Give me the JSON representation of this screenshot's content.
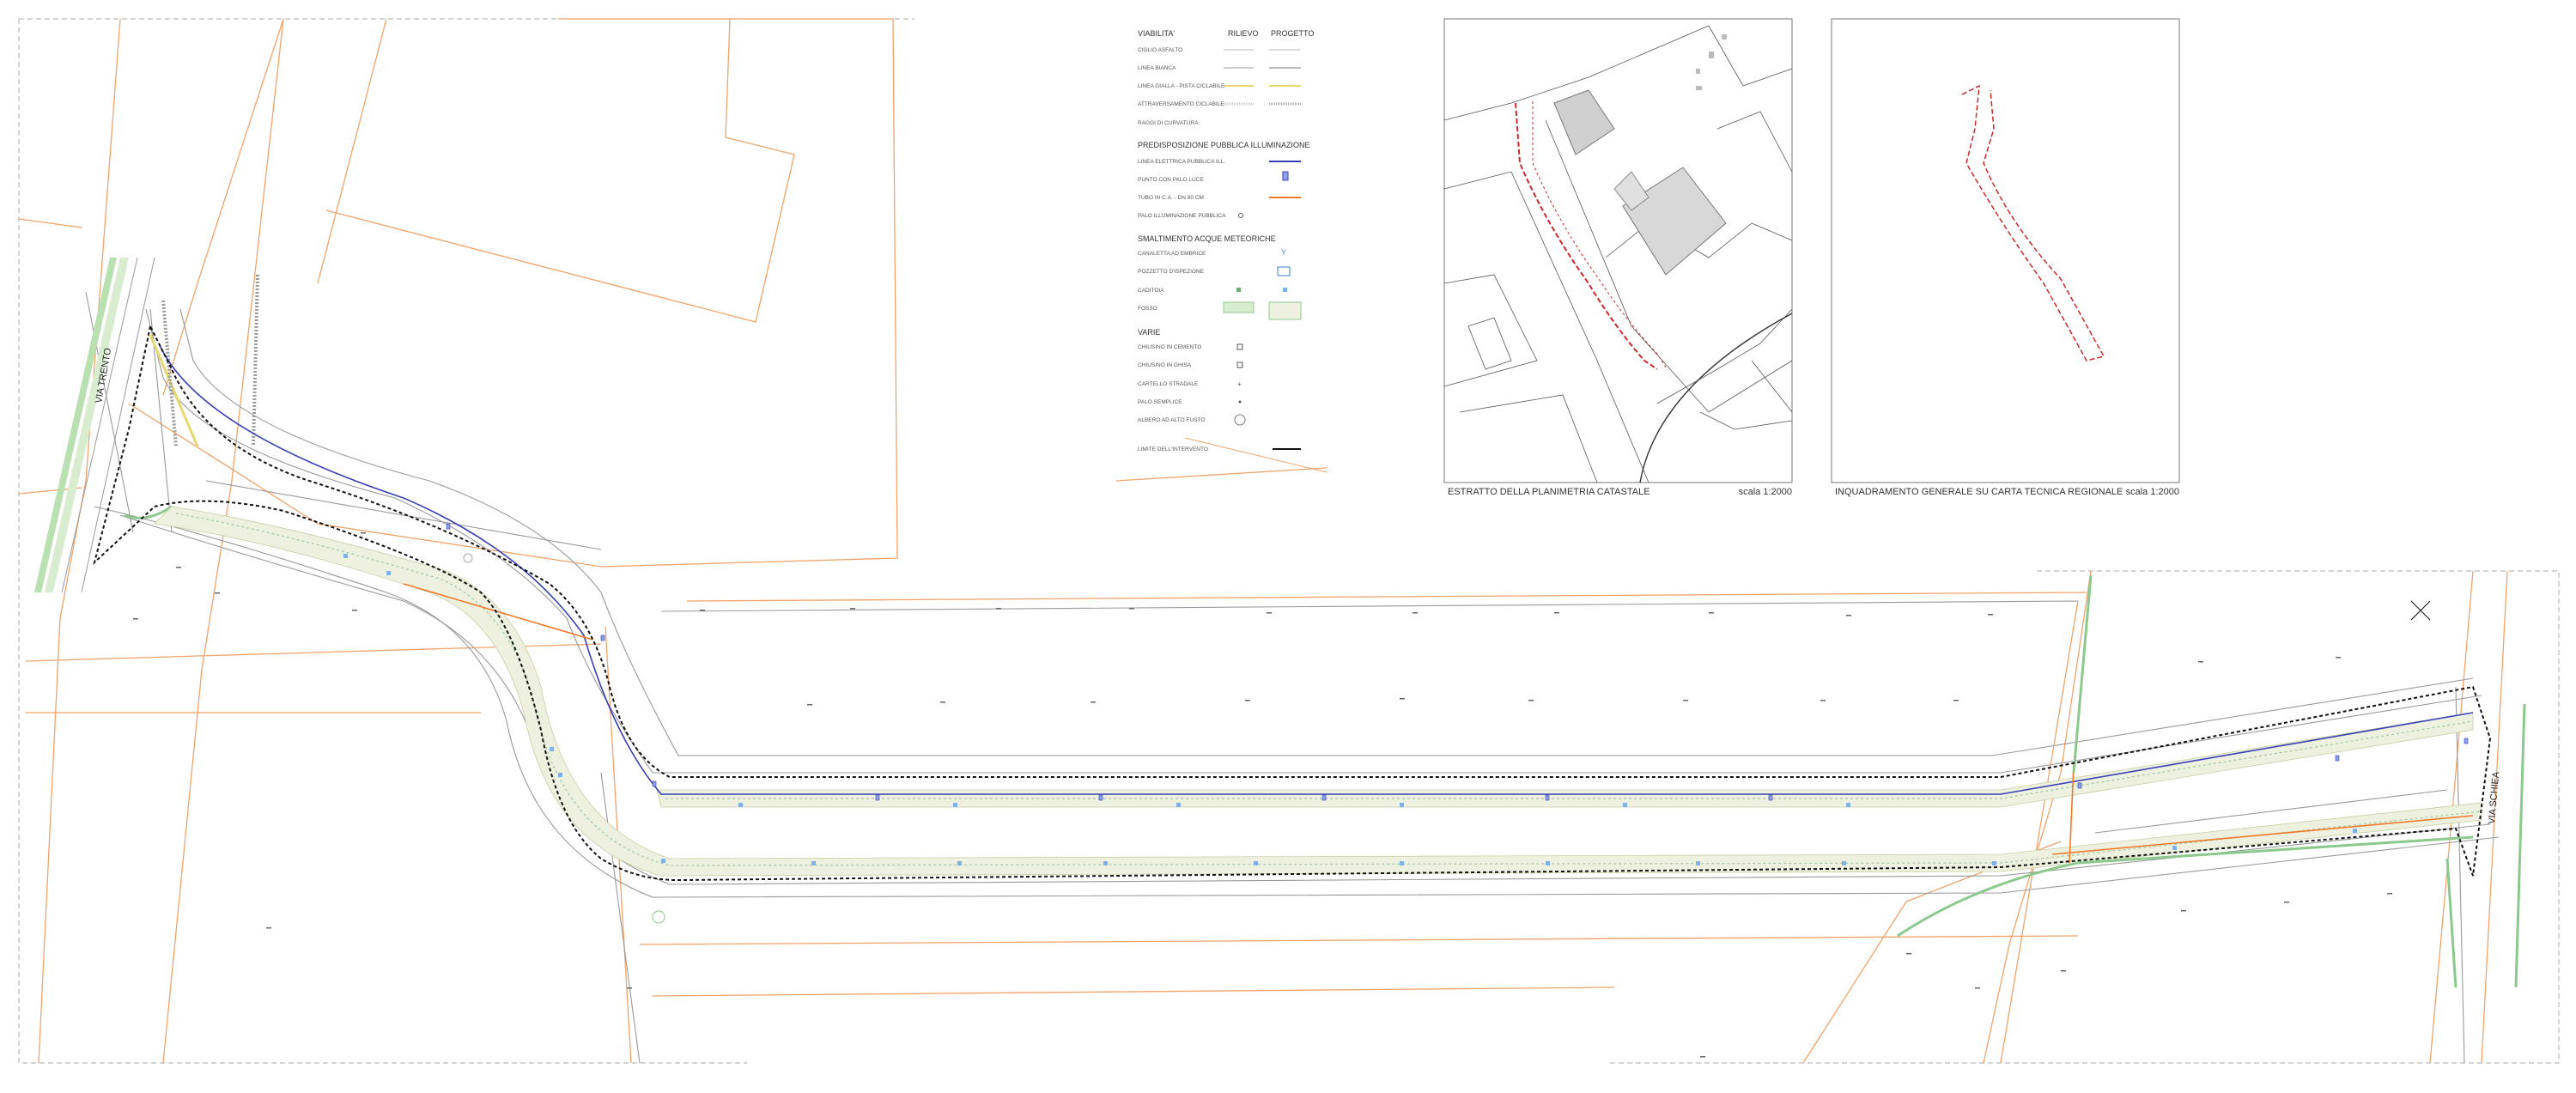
{
  "legend": {
    "viabilita": "VIABILITA'",
    "col_rilievo": "RILIEVO",
    "col_progetto": "PROGETTO",
    "viabilita_items": [
      "CIGLIO ASFALTO",
      "LINEA BIANCA",
      "LINEA GIALLA - PISTA CICLABILE",
      "ATTRAVERSAMENTO CICLABILE",
      "RAGGI DI CURVATURA"
    ],
    "illuminazione_title": "PREDISPOSIZIONE PUBBLICA ILLUMINAZIONE",
    "illuminazione_items": [
      "LINEA ELETTRICA PUBBLICA ILL.",
      "PUNTO CON PALO LUCE",
      "TUBO IN C.A. - DN 80 CM",
      "PALO ILLUMINAZIONE PUBBLICA"
    ],
    "acque_title": "SMALTIMENTO ACQUE METEORICHE",
    "acque_items": [
      "CANALETTA AD EMBRICE",
      "POZZETTO D'ISPEZIONE",
      "CADITOIA",
      "FOSSO"
    ],
    "varie_title": "VARIE",
    "varie_items": [
      "CHIUSINO IN CEMENTO",
      "CHIUSINO IN GHISA",
      "CARTELLO STRADALE",
      "PALO SEMPLICE",
      "ALBERO AD ALTO FUSTO"
    ],
    "limite_label": "LIMITE DELL'INTERVENTO"
  },
  "insets": {
    "catastale": {
      "caption": "ESTRATTO DELLA PLANIMETRIA CATASTALE",
      "scale": "scala 1:2000"
    },
    "regionale": {
      "caption": "INQUADRAMENTO GENERALE SU CARTA TECNICA REGIONALE",
      "scale": "scala 1:2000"
    }
  },
  "roads": {
    "via_left": "VIA TRENTO",
    "via_right": "VIA SCHIEA"
  },
  "colors": {
    "cadastral": "#f0a36a",
    "lighting": "#3a3fb5",
    "bike_lane": "#e8d870",
    "pipe": "#f07a2a",
    "ditch": "#8cc98c",
    "limit": "#111111",
    "inset_red": "#cc2a2a"
  }
}
